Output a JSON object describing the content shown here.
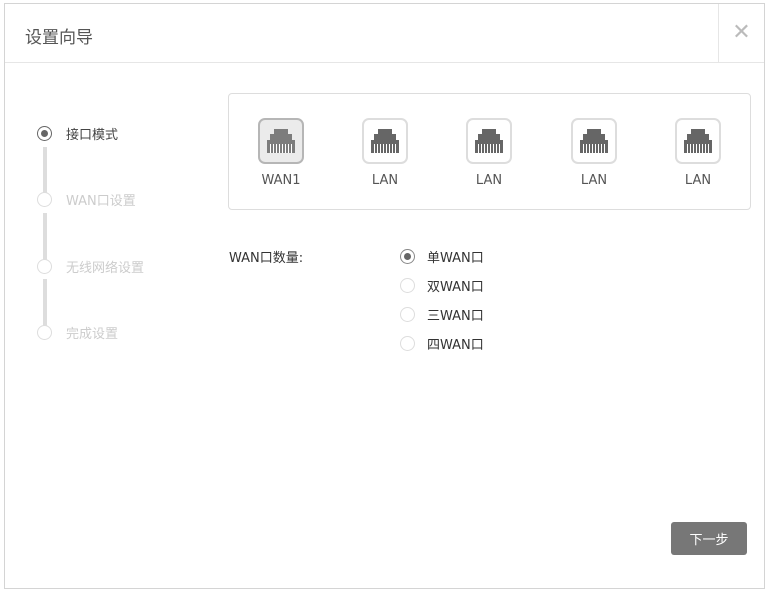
{
  "dialog": {
    "title": "设置向导",
    "close_icon": "close-icon"
  },
  "steps": [
    {
      "label": "接口模式",
      "active": true
    },
    {
      "label": "WAN口设置",
      "active": false
    },
    {
      "label": "无线网络设置",
      "active": false
    },
    {
      "label": "完成设置",
      "active": false
    }
  ],
  "ports": [
    {
      "label": "WAN1",
      "selected": true
    },
    {
      "label": "LAN",
      "selected": false
    },
    {
      "label": "LAN",
      "selected": false
    },
    {
      "label": "LAN",
      "selected": false
    },
    {
      "label": "LAN",
      "selected": false
    }
  ],
  "wan_count": {
    "label": "WAN口数量:",
    "options": [
      {
        "label": "单WAN口",
        "checked": true
      },
      {
        "label": "双WAN口",
        "checked": false
      },
      {
        "label": "三WAN口",
        "checked": false
      },
      {
        "label": "四WAN口",
        "checked": false
      }
    ]
  },
  "next_button": "下一步"
}
